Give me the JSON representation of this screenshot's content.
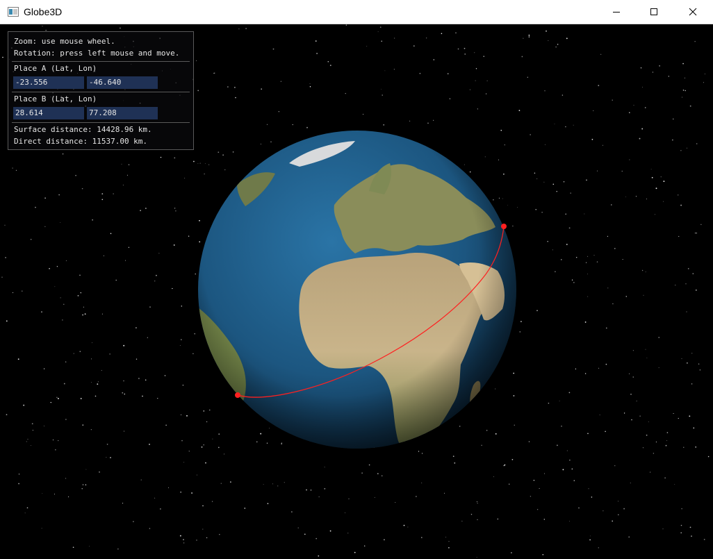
{
  "window": {
    "title": "Globe3D",
    "minimize_icon": "minimize-icon",
    "maximize_icon": "maximize-icon",
    "close_icon": "close-icon"
  },
  "panel": {
    "zoom_hint": "Zoom: use mouse wheel.",
    "rotation_hint": "Rotation: press left mouse and move.",
    "place_a": {
      "label": "Place A (Lat, Lon)",
      "lat": "-23.556",
      "lon": "-46.640"
    },
    "place_b": {
      "label": "Place B (Lat, Lon)",
      "lat": "28.614",
      "lon": "77.208"
    },
    "surface_distance": "Surface distance: 14428.96 km.",
    "direct_distance": "Direct distance: 11537.00 km."
  },
  "colors": {
    "route": "#ff2020",
    "field_bg": "#1f3155",
    "ocean": "#1f5a86"
  }
}
